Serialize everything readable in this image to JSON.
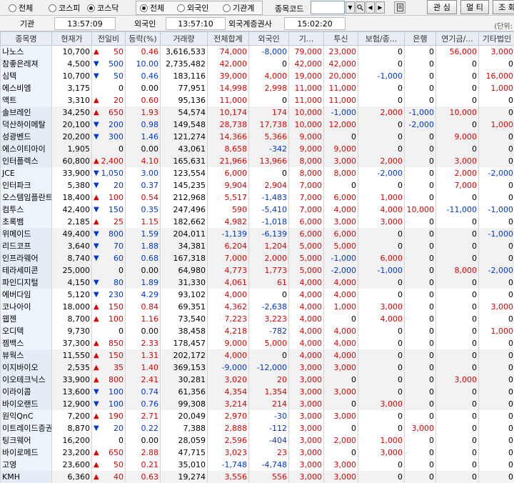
{
  "toolbar": {
    "market_radios": [
      {
        "label": "전체",
        "selected": false
      },
      {
        "label": "코스피",
        "selected": false
      },
      {
        "label": "코스닥",
        "selected": true
      }
    ],
    "investor_radios": [
      {
        "label": "전체",
        "selected": true
      },
      {
        "label": "외국인",
        "selected": false
      },
      {
        "label": "기관계",
        "selected": false
      }
    ],
    "code_label": "종목코드",
    "code_value": "",
    "buttons": [
      "관 심",
      "멀 티",
      "조 회"
    ]
  },
  "times": [
    {
      "label": "기관",
      "value": "13:57:09"
    },
    {
      "label": "외국인",
      "value": "13:57:10"
    },
    {
      "label": "외국계증권사",
      "value": "15:02:20"
    }
  ],
  "unit_label": "(단위:",
  "colors": {
    "up": "#e00000",
    "down": "#0035d6",
    "header_bg": "#e9eef5"
  },
  "table": {
    "headers": [
      "종목명",
      "현재가",
      "전일비",
      "등락(%)",
      "거래량",
      "전체합계",
      "외국인",
      "기...",
      "투신",
      "보험/종...",
      "은행",
      "연기금/...",
      "기타법인"
    ],
    "rows": [
      [
        "나노스",
        "10,700",
        "up",
        "50",
        "0.46",
        "3,616,533",
        "74,000",
        "-8,000",
        "79,000",
        "23,000",
        "0",
        "0",
        "56,000",
        "3,000"
      ],
      [
        "참좋은레져",
        "4,500",
        "down",
        "500",
        "10.00",
        "2,735,482",
        "42,000",
        "0",
        "42,000",
        "42,000",
        "0",
        "0",
        "0",
        "0"
      ],
      [
        "심텍",
        "10,700",
        "down",
        "50",
        "0.46",
        "183,116",
        "39,000",
        "4,000",
        "19,000",
        "20,000",
        "-1,000",
        "0",
        "0",
        "16,000"
      ],
      [
        "에스비엠",
        "3,175",
        "",
        "0",
        "0.00",
        "77,951",
        "14,998",
        "2,998",
        "11,000",
        "11,000",
        "0",
        "0",
        "0",
        "1,000"
      ],
      [
        "액트",
        "3,310",
        "up",
        "20",
        "0.60",
        "95,136",
        "11,000",
        "0",
        "11,000",
        "11,000",
        "0",
        "0",
        "0",
        "0"
      ],
      [
        "솔브레인",
        "34,250",
        "up",
        "650",
        "1.93",
        "54,574",
        "10,174",
        "174",
        "10,000",
        "-1,000",
        "2,000",
        "-1,000",
        "10,000",
        "0"
      ],
      [
        "덕산하이메탈",
        "20,100",
        "down",
        "200",
        "0.98",
        "149,548",
        "28,738",
        "17,738",
        "10,000",
        "12,000",
        "0",
        "-2,000",
        "0",
        "1,000"
      ],
      [
        "성광벤드",
        "20,200",
        "down",
        "300",
        "1.46",
        "121,274",
        "14,366",
        "5,366",
        "9,000",
        "0",
        "0",
        "0",
        "9,000",
        "0"
      ],
      [
        "에스이티아이",
        "1,905",
        "",
        "0",
        "0.00",
        "43,061",
        "8,658",
        "-342",
        "9,000",
        "9,000",
        "0",
        "0",
        "0",
        "0"
      ],
      [
        "인터플렉스",
        "60,800",
        "up",
        "2,400",
        "4.10",
        "165,631",
        "21,966",
        "13,966",
        "8,000",
        "3,000",
        "2,000",
        "0",
        "3,000",
        "0"
      ],
      [
        "JCE",
        "33,900",
        "down",
        "1,050",
        "3.00",
        "123,554",
        "6,000",
        "0",
        "8,000",
        "8,000",
        "-2,000",
        "0",
        "2,000",
        "-2,000"
      ],
      [
        "인터파크",
        "5,380",
        "down",
        "20",
        "0.37",
        "145,235",
        "9,904",
        "2,904",
        "7,000",
        "0",
        "0",
        "0",
        "7,000",
        "0"
      ],
      [
        "오스템임플란트",
        "18,400",
        "up",
        "100",
        "0.54",
        "212,968",
        "5,517",
        "-1,483",
        "7,000",
        "6,000",
        "1,000",
        "0",
        "0",
        "0"
      ],
      [
        "컴투스",
        "42,400",
        "down",
        "150",
        "0.35",
        "247,496",
        "590",
        "-5,410",
        "7,000",
        "4,000",
        "4,000",
        "10,000",
        "-11,000",
        "-1,000"
      ],
      [
        "초록뱀",
        "2,185",
        "up",
        "25",
        "1.15",
        "182,662",
        "4,982",
        "-1,018",
        "6,000",
        "3,000",
        "3,000",
        "0",
        "0",
        "0"
      ],
      [
        "위메이드",
        "49,400",
        "down",
        "800",
        "1.59",
        "204,011",
        "-1,139",
        "-6,139",
        "6,000",
        "6,000",
        "0",
        "0",
        "0",
        "-1,000"
      ],
      [
        "리드코프",
        "3,640",
        "down",
        "70",
        "1.88",
        "34,381",
        "6,204",
        "1,204",
        "5,000",
        "5,000",
        "0",
        "0",
        "0",
        "0"
      ],
      [
        "인프라웨어",
        "8,740",
        "down",
        "60",
        "0.68",
        "167,318",
        "7,000",
        "2,000",
        "5,000",
        "-1,000",
        "6,000",
        "0",
        "0",
        "0"
      ],
      [
        "테라세미콘",
        "25,000",
        "",
        "0",
        "0.00",
        "64,980",
        "4,773",
        "1,773",
        "5,000",
        "-2,000",
        "-1,000",
        "0",
        "8,000",
        "-2,000"
      ],
      [
        "파인디지털",
        "4,150",
        "down",
        "80",
        "1.89",
        "31,330",
        "4,061",
        "61",
        "4,000",
        "4,000",
        "0",
        "0",
        "0",
        "0"
      ],
      [
        "에버다임",
        "5,120",
        "down",
        "230",
        "4.29",
        "93,102",
        "4,000",
        "0",
        "4,000",
        "4,000",
        "0",
        "0",
        "0",
        "0"
      ],
      [
        "코나아이",
        "18,000",
        "up",
        "150",
        "0.84",
        "69,351",
        "4,362",
        "-2,638",
        "4,000",
        "1,000",
        "3,000",
        "0",
        "0",
        "3,000"
      ],
      [
        "웹젠",
        "8,700",
        "up",
        "100",
        "1.16",
        "73,540",
        "7,223",
        "3,223",
        "4,000",
        "0",
        "4,000",
        "0",
        "0",
        "0"
      ],
      [
        "오디텍",
        "9,730",
        "",
        "0",
        "0.00",
        "38,458",
        "4,218",
        "-782",
        "4,000",
        "4,000",
        "0",
        "0",
        "0",
        "1,000"
      ],
      [
        "젬백스",
        "37,300",
        "up",
        "850",
        "2.33",
        "178,457",
        "9,000",
        "5,000",
        "4,000",
        "4,000",
        "0",
        "0",
        "0",
        "0"
      ],
      [
        "뷰웍스",
        "11,550",
        "up",
        "150",
        "1.31",
        "202,172",
        "4,000",
        "0",
        "4,000",
        "4,000",
        "0",
        "0",
        "0",
        "0"
      ],
      [
        "이지바이오",
        "2,535",
        "up",
        "35",
        "1.40",
        "369,153",
        "-9,000",
        "-12,000",
        "3,000",
        "3,000",
        "0",
        "0",
        "0",
        "0"
      ],
      [
        "이오테크닉스",
        "33,900",
        "up",
        "800",
        "2.41",
        "30,281",
        "3,020",
        "20",
        "3,000",
        "0",
        "0",
        "0",
        "3,000",
        "0"
      ],
      [
        "이라이콤",
        "13,600",
        "down",
        "100",
        "0.74",
        "61,356",
        "4,354",
        "1,354",
        "3,000",
        "3,000",
        "0",
        "0",
        "0",
        "0"
      ],
      [
        "바이오랜드",
        "12,900",
        "down",
        "100",
        "0.76",
        "99,308",
        "3,214",
        "214",
        "3,000",
        "0",
        "3,000",
        "0",
        "0",
        "0"
      ],
      [
        "원익QnC",
        "7,200",
        "up",
        "190",
        "2.71",
        "20,049",
        "2,970",
        "-30",
        "3,000",
        "3,000",
        "0",
        "0",
        "0",
        "0"
      ],
      [
        "이트레이드증권",
        "8,870",
        "down",
        "20",
        "0.22",
        "7,388",
        "2,888",
        "-112",
        "3,000",
        "0",
        "0",
        "3,000",
        "0",
        "0"
      ],
      [
        "팅크웨어",
        "16,200",
        "",
        "0",
        "0.00",
        "28,059",
        "2,596",
        "-404",
        "3,000",
        "2,000",
        "1,000",
        "0",
        "0",
        "0"
      ],
      [
        "바이로메드",
        "23,200",
        "up",
        "650",
        "2.88",
        "47,715",
        "3,023",
        "23",
        "3,000",
        "0",
        "3,000",
        "0",
        "0",
        "0"
      ],
      [
        "고영",
        "23,600",
        "up",
        "50",
        "0.21",
        "35,010",
        "-1,748",
        "-4,748",
        "3,000",
        "3,000",
        "0",
        "0",
        "0",
        "0"
      ],
      [
        "KMH",
        "6,360",
        "up",
        "40",
        "0.63",
        "19,274",
        "3,556",
        "556",
        "3,000",
        "3,000",
        "0",
        "0",
        "0",
        "0"
      ]
    ]
  }
}
